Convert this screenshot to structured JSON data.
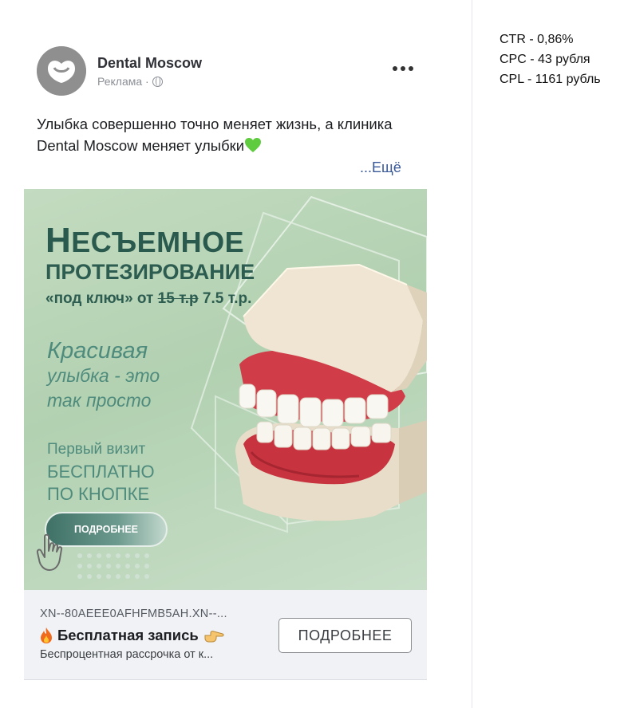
{
  "metrics": {
    "ctr": "CTR - 0,86%",
    "cpc": "CPC - 43 рубля",
    "cpl": "CPL - 1161 рубль"
  },
  "post": {
    "page_name": "Dental Moscow",
    "sponsored_label": "Реклама ·",
    "text": "Улыбка совершенно точно меняет жизнь, а клиника Dental Moscow меняет улыбки",
    "see_more": "...Ещё"
  },
  "creative": {
    "headline_big_first": "Н",
    "headline_rest": "ЕСЪЕМНОЕ",
    "headline_line2": "ПРОТЕЗИРОВАНИЕ",
    "offer_prefix": "«под ключ» от",
    "offer_old_price": "15 т.р",
    "offer_new_price": "7.5 т.р.",
    "tagline_line1": "Красивая",
    "tagline_line2": "улыбка - это",
    "tagline_line3": "так просто",
    "visit_line1": "Первый визит",
    "visit_line2": "БЕСПЛАТНО",
    "visit_line3": "ПО КНОПКЕ",
    "cta_pill": "ПОДРОБНЕЕ"
  },
  "footer": {
    "domain": "XN--80AEEE0AFHFMB5AH.XN--...",
    "headline": "Бесплатная запись",
    "description": "Беспроцентная рассрочка от к...",
    "button": "ПОДРОБНЕЕ"
  },
  "colors": {
    "brand_green": "#2a5a4e",
    "link_blue": "#385898",
    "footer_bg": "#f0f2f5"
  }
}
